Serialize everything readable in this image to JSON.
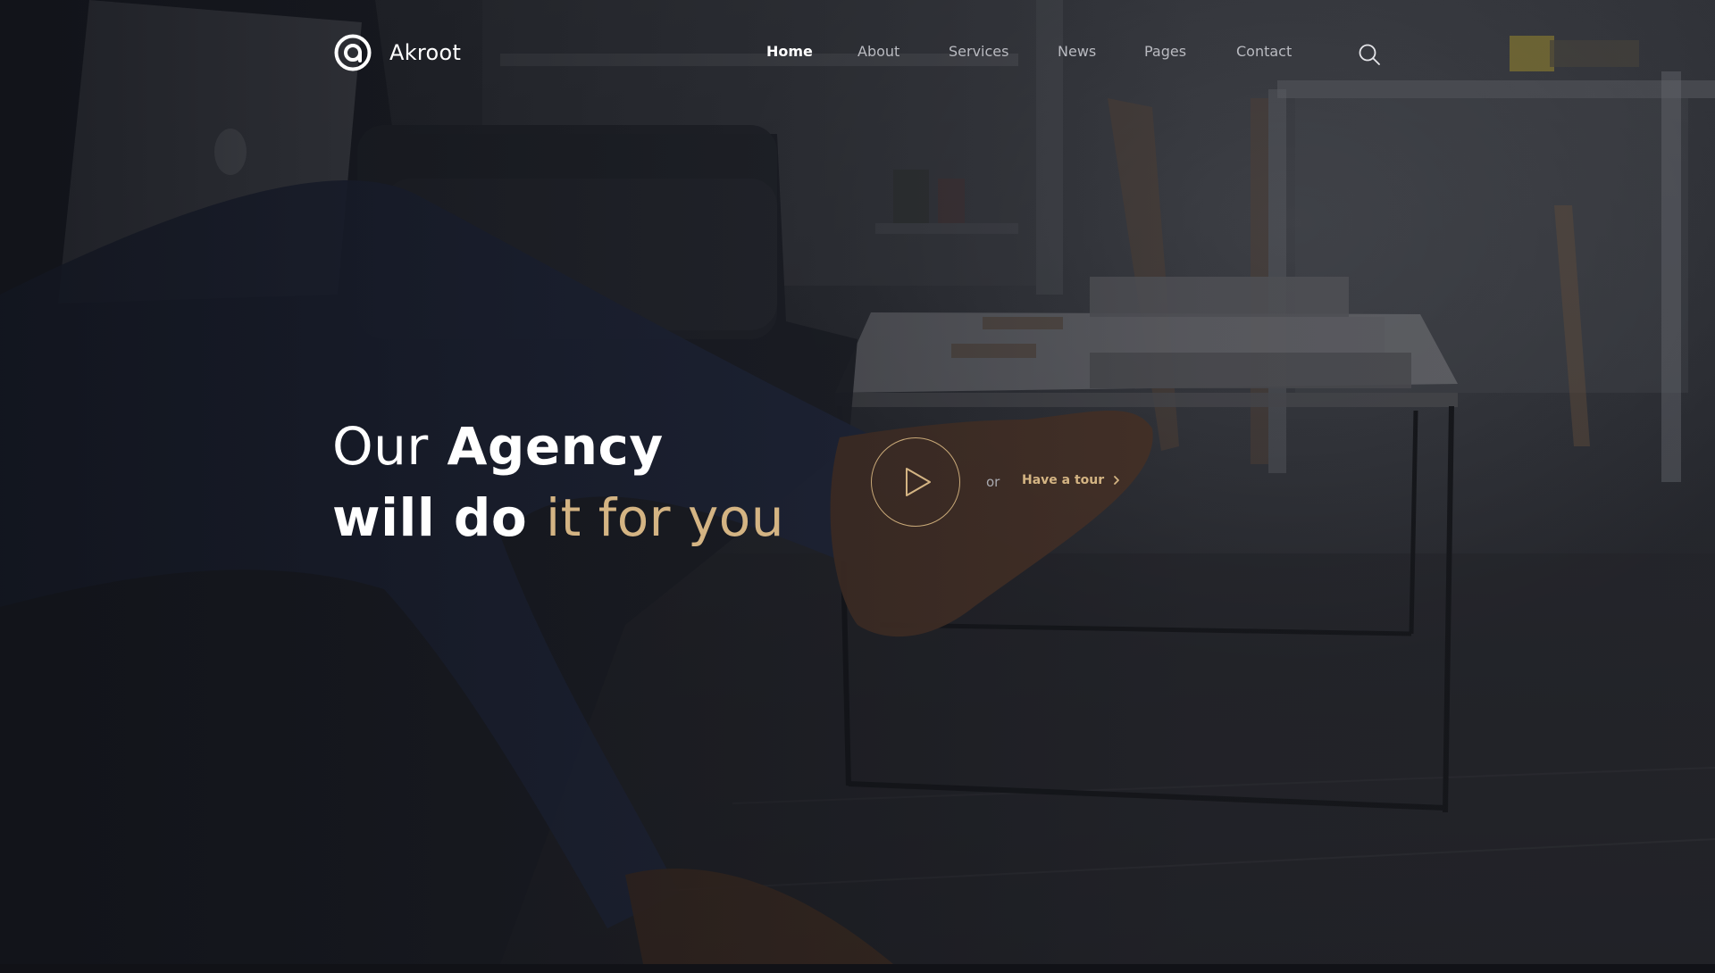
{
  "brand": {
    "name": "Akroot",
    "logo_icon": "at-sign-icon"
  },
  "nav": {
    "items": [
      {
        "label": "Home",
        "active": true
      },
      {
        "label": "About",
        "active": false
      },
      {
        "label": "Services",
        "active": false
      },
      {
        "label": "News",
        "active": false
      },
      {
        "label": "Pages",
        "active": false
      },
      {
        "label": "Contact",
        "active": false
      }
    ],
    "search_icon": "search-icon"
  },
  "hero": {
    "line1_light": "Our",
    "line1_bold": "Agency",
    "line2_bold": "will do",
    "line2_accent": "it for you",
    "play_icon": "play-icon",
    "or_text": "or",
    "tour_label": "Have a tour",
    "tour_icon": "chevron-right-icon"
  },
  "colors": {
    "accent": "#d4b483",
    "text": "#ffffff",
    "nav_text": "#b9bac0",
    "overlay": "#0e1016"
  }
}
